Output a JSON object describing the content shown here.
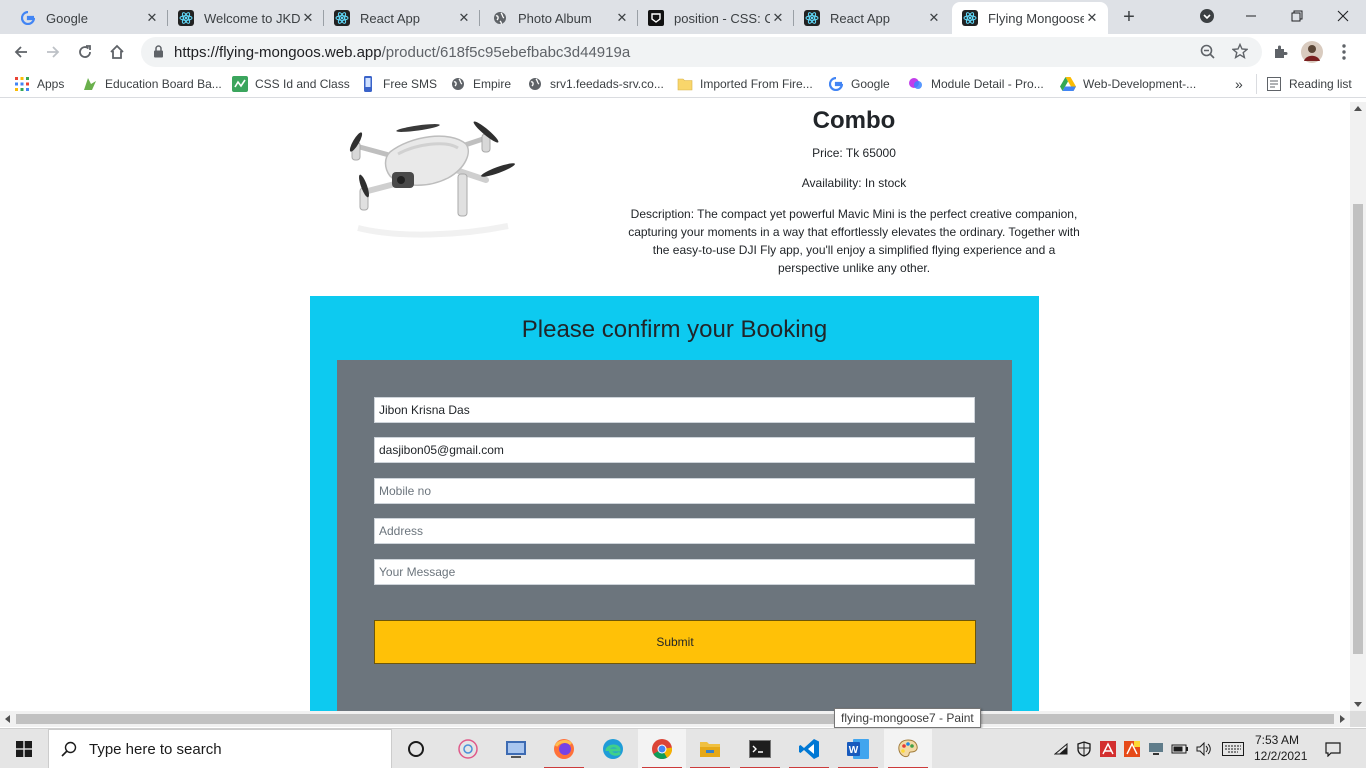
{
  "browser": {
    "tabs": [
      {
        "title": "Google",
        "icon": "google-icon"
      },
      {
        "title": "Welcome to JKD's",
        "icon": "react-icon"
      },
      {
        "title": "React App",
        "icon": "react-icon"
      },
      {
        "title": "Photo Album",
        "icon": "globe-icon"
      },
      {
        "title": "position - CSS: Ca",
        "icon": "codepen-icon"
      },
      {
        "title": "React App",
        "icon": "react-icon"
      },
      {
        "title": "Flying Mongoose",
        "icon": "react-icon",
        "active": true
      }
    ],
    "url_host": "https://flying-mongoos.web.app",
    "url_path": "/product/618f5c95ebefbabc3d44919a",
    "bookmarks": [
      {
        "label": "Apps",
        "icon": "apps-grid-icon"
      },
      {
        "label": "Education Board Ba...",
        "icon": "education-board-icon"
      },
      {
        "label": "CSS Id and Class",
        "icon": "css-icon"
      },
      {
        "label": "Free SMS",
        "icon": "phone-icon"
      },
      {
        "label": "Empire",
        "icon": "globe-icon"
      },
      {
        "label": "srv1.feedads-srv.co...",
        "icon": "globe-icon"
      },
      {
        "label": "Imported From Fire...",
        "icon": "folder-icon"
      },
      {
        "label": "Google",
        "icon": "google-icon"
      },
      {
        "label": "Module Detail - Pro...",
        "icon": "module-icon"
      },
      {
        "label": "Web-Development-...",
        "icon": "google-drive-icon"
      }
    ],
    "more_bookmarks": "»",
    "reading_list": "Reading list"
  },
  "product": {
    "name": "Combo",
    "price": "Price: Tk 65000",
    "availability": "Availability: In stock",
    "description": "Description: The compact yet powerful Mavic Mini is the perfect creative companion, capturing your moments in a way that effortlessly elevates the ordinary. Together with the easy-to-use DJI Fly app, you'll enjoy a simplified flying experience and a perspective unlike any other."
  },
  "booking": {
    "heading": "Please confirm your Booking",
    "name_value": "Jibon Krisna Das",
    "email_value": "dasjibon05@gmail.com",
    "mobile_placeholder": "Mobile no",
    "address_placeholder": "Address",
    "message_placeholder": "Your Message",
    "submit_label": "Submit"
  },
  "tooltip": "flying-mongoose7 - Paint",
  "taskbar": {
    "search_placeholder": "Type here to search",
    "time": "7:53 AM",
    "date": "12/2/2021"
  },
  "colors": {
    "booking_bg": "#0dcaf0",
    "form_bg": "#6c757d",
    "submit_bg": "#ffc107"
  }
}
